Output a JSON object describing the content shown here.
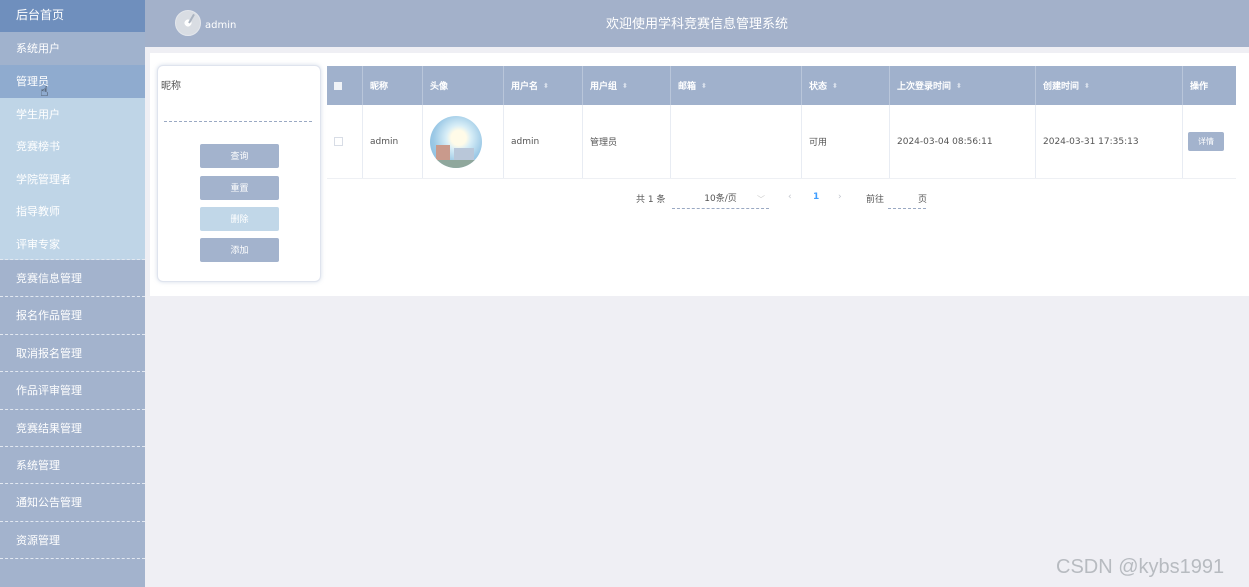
{
  "sidebar": {
    "top": "后台首页",
    "group": "系统用户",
    "sub_items": [
      "管理员",
      "学生用户",
      "竞赛榜书",
      "学院管理者",
      "指导教师",
      "评审专家"
    ],
    "items": [
      "竞赛信息管理",
      "报名作品管理",
      "取消报名管理",
      "作品评审管理",
      "竞赛结果管理",
      "系统管理",
      "通知公告管理",
      "资源管理"
    ]
  },
  "header": {
    "username": "admin",
    "title": "欢迎使用学科竞赛信息管理系统"
  },
  "search": {
    "label": "昵称",
    "value": "",
    "buttons": {
      "query": "查询",
      "reset": "重置",
      "delete": "删除",
      "add": "添加"
    }
  },
  "table": {
    "columns": [
      "昵称",
      "头像",
      "用户名",
      "用户组",
      "邮箱",
      "状态",
      "上次登录时间",
      "创建时间",
      "操作"
    ],
    "rows": [
      {
        "nickname": "admin",
        "username": "admin",
        "group": "管理员",
        "email": "",
        "status": "可用",
        "last_login": "2024-03-04 08:56:11",
        "created": "2024-03-31 17:35:13",
        "action": "详情"
      }
    ]
  },
  "pagination": {
    "total": "共 1 条",
    "page_size": "10条/页",
    "current": "1",
    "goto_prefix": "前往",
    "goto_suffix": "页"
  },
  "watermark": "CSDN @kybs1991",
  "colors": {
    "sidebar": "#a3b3cd",
    "header": "#a3b1ca",
    "accent": "#6f8fbd",
    "active_page": "#409eff"
  }
}
